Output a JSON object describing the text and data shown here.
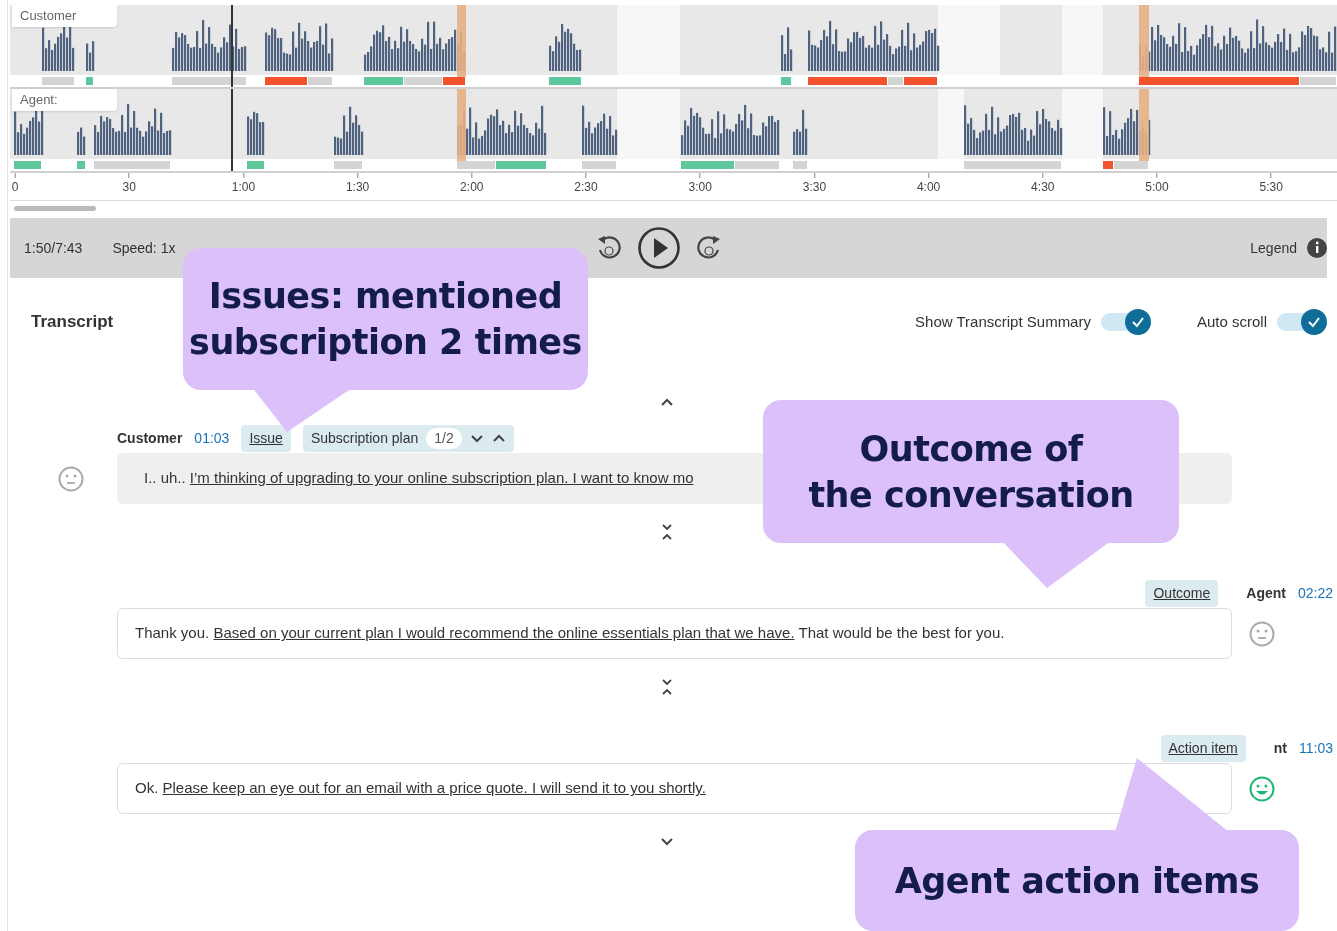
{
  "timeline": {
    "tracks": [
      {
        "label": "Customer"
      },
      {
        "label": "Agent:"
      }
    ],
    "axis_labels": [
      "0",
      "30",
      "1:00",
      "1:30",
      "2:00",
      "2:30",
      "3:00",
      "3:30",
      "4:00",
      "4:30",
      "5:00",
      "5:30"
    ]
  },
  "player": {
    "time": "1:50/7:43",
    "speed": "Speed: 1x",
    "legend": "Legend"
  },
  "transcript": {
    "title": "Transcript",
    "toggles": [
      {
        "label": "Show Transcript Summary",
        "on": true
      },
      {
        "label": "Auto scroll",
        "on": true
      }
    ],
    "messages": [
      {
        "kind": "customer",
        "speaker": "Customer",
        "time": "01:03",
        "highlighted": true,
        "happy": false,
        "tags": [
          {
            "kind": "tag",
            "label": "Issue"
          },
          {
            "kind": "counter",
            "label": "Subscription plan",
            "count": "1/2"
          }
        ],
        "parts": [
          {
            "text": "I.. uh.. ",
            "underlined": false
          },
          {
            "text": "I’m thinking of upgrading to your online subscription plan. I want to know mo",
            "underlined": true
          }
        ]
      },
      {
        "kind": "agent",
        "speaker": "Agent",
        "time": "02:22",
        "highlighted": false,
        "happy": false,
        "tags": [
          {
            "kind": "tag",
            "label": "Outcome"
          }
        ],
        "parts": [
          {
            "text": "Thank you. ",
            "underlined": false
          },
          {
            "text": "Based on your current plan I would recommend the online essentials plan that we have.",
            "underlined": true
          },
          {
            "text": " That would be the best for you.",
            "underlined": false
          }
        ]
      },
      {
        "kind": "agent",
        "speaker": "nt",
        "time": "11:03",
        "highlighted": false,
        "happy": true,
        "tags": [
          {
            "kind": "tag",
            "label": "Action item"
          }
        ],
        "parts": [
          {
            "text": "Ok. ",
            "underlined": false
          },
          {
            "text": "Please keep an eye out for an email with a price quote. I will send it to you shortly.",
            "underlined": true
          }
        ]
      }
    ]
  },
  "callouts": [
    {
      "lines": [
        "Issues: mentioned",
        "subscription 2 times"
      ],
      "kind": "left"
    },
    {
      "lines": [
        "Outcome of",
        "the conversation"
      ],
      "kind": "right"
    },
    {
      "lines": [
        "Agent action items"
      ],
      "kind": "bottom"
    }
  ]
}
